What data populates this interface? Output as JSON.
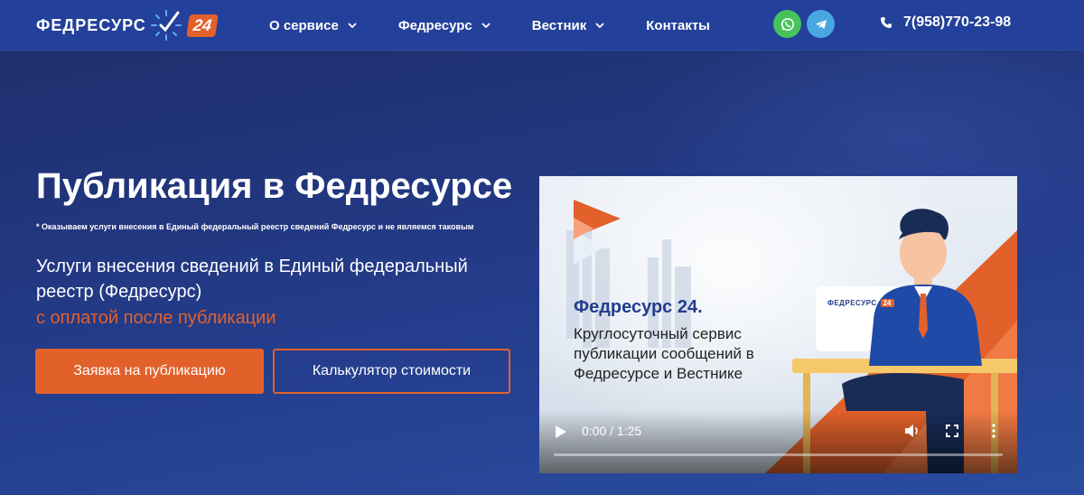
{
  "header": {
    "logo_text": "ФЕДРЕСУРС",
    "logo_badge": "24",
    "nav": [
      {
        "label": "О сервисе",
        "has_dropdown": true
      },
      {
        "label": "Федресурс",
        "has_dropdown": true
      },
      {
        "label": "Вестник",
        "has_dropdown": true
      },
      {
        "label": "Контакты",
        "has_dropdown": false
      }
    ],
    "social": [
      {
        "icon": "whatsapp-icon",
        "color": "#46c35b"
      },
      {
        "icon": "telegram-icon",
        "color": "#49a7e0"
      }
    ],
    "phone": "7(958)770-23-98"
  },
  "hero": {
    "title": "Публикация в Федресурсе",
    "note": "* Оказываем услуги внесения в Единый федеральный реестр сведений Федресурс и не являемся таковым",
    "subtitle": "Услуги внесения сведений в Единый федеральный реестр (Федресурс)",
    "accent": "с оплатой после публикации",
    "primary_button": "Заявка на публикацию",
    "secondary_button": "Калькулятор стоимости"
  },
  "video": {
    "heading": "Федресурс 24.",
    "text": "Круглосуточный сервис публикации сообщений в Федресурсе и Вестнике",
    "screen_logo": "ФЕДРЕСУРС",
    "screen_badge": "24",
    "time": "0:00 / 1:25",
    "progress": 0
  },
  "colors": {
    "accent": "#e2612b",
    "header_bg": "#23409a",
    "hero_bg": "#23387f",
    "brand_blue": "#233d8c"
  }
}
